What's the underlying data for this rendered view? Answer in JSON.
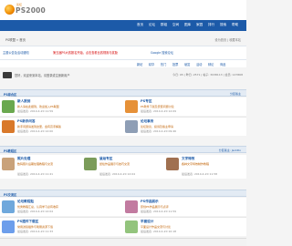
{
  "site": {
    "logo_text": "PS2000",
    "logo_sub": "论坛"
  },
  "nav": {
    "items": [
      "首页",
      "论坛",
      "群组",
      "空间",
      "图库",
      "家园",
      "排行",
      "搜索",
      "帮助"
    ]
  },
  "breadcrumb": "PS联盟 » 首页",
  "right_links": "设为首页 | 收藏本站",
  "announcement": {
    "a": "主题公告及活动通知",
    "b": "第五届PS大赛报名开始，点击查看比赛规则与奖励",
    "c": "Google 搜索论坛"
  },
  "subnav": {
    "tabs": [
      "新帖",
      "精华",
      "热门",
      "投票",
      "悬赏",
      "活动",
      "辩论",
      "商品"
    ]
  },
  "search": {
    "welcome": "您好，欢迎来到本站，请登录或注册新用户",
    "stats": "今日: 65 | 昨日: 2571 | 帖子: 3038113 | 会员: 147868"
  },
  "sections": {
    "s1": {
      "title": "PS综合区",
      "right": "分区版主"
    },
    "s2": {
      "title": "PS教程区",
      "right": "分区版主: JackDo"
    },
    "s3": {
      "title": "PS交流区",
      "right": ""
    }
  },
  "forums": [
    {
      "title": "新人报到",
      "desc": "新人请在此报到，欢迎加入PS联盟",
      "time": "最后发表: 2010-4-20 11:59"
    },
    {
      "title": "PS专区",
      "desc": "PS软件下载及安装问题讨论",
      "time": "最后发表: 2010-4-20 12:09"
    },
    {
      "title": "PS新手问答",
      "desc": "新手问题请发到这里，会有高手解答",
      "time": "最后发表: 2010-4-20 12:00"
    },
    {
      "title": "论坛事务",
      "desc": "论坛建议、投诉及版主申请",
      "time": "最后发表: 2010-4-20 09:46"
    },
    {
      "title": "照片处理",
      "desc": "数码照片后期处理教程与交流",
      "time": "最后发表: 2010-4-20 11:41"
    },
    {
      "title": "鼠绘专区",
      "desc": "鼠绘作品展示与技巧交流",
      "time": "最后发表: 2010-4-20 12:04"
    },
    {
      "title": "文字特效",
      "desc": "各种文字特效制作教程",
      "time": "最后发表: 2010-4-20 11:58"
    },
    {
      "title": "论坛教程贴",
      "desc": "优秀教程汇总，认真学习必有收获",
      "time": "最后发表: 2010-4-20 12:04"
    },
    {
      "title": "PS作品展示",
      "desc": "原创PS作品展示与点评",
      "time": "最后发表: 2010-4-20 11:59"
    },
    {
      "title": "PS插件下载区",
      "desc": "常用滤镜插件与笔刷资源下载",
      "time": "最后发表: 2010-4-20 11:33"
    },
    {
      "title": "平面设计",
      "desc": "平面设计作品交流与讨论",
      "time": "最后发表: 2010-4-20 10:18"
    }
  ],
  "colors": {
    "accent": "#1c5aa8",
    "orange": "#f08a00",
    "link": "#1c5aa8"
  }
}
